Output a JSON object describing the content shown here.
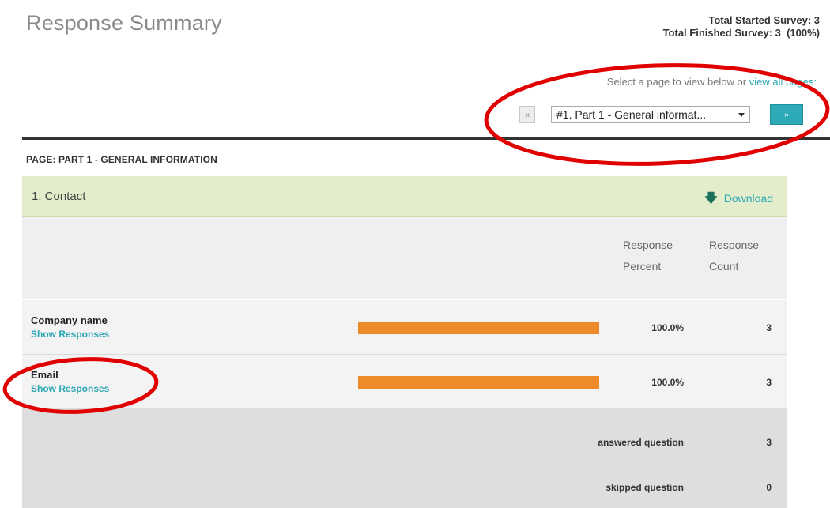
{
  "header": {
    "title": "Response Summary",
    "total_started": "Total Started Survey: 3",
    "total_finished": "Total Finished Survey: 3  (100%)"
  },
  "page_nav": {
    "hint_prefix": "Select a page to view below or ",
    "hint_link": "view all pages",
    "hint_suffix": ":",
    "prev_label": "«",
    "selected_page": "#1. Part 1 - General informat...",
    "next_label": "»"
  },
  "page_label": "PAGE: PART 1 - GENERAL INFORMATION",
  "question": {
    "title": "1. Contact",
    "download_label": "Download",
    "columns": {
      "percent_line1": "Response",
      "percent_line2": "Percent",
      "count_line1": "Response",
      "count_line2": "Count"
    },
    "rows": [
      {
        "label": "Company name",
        "link": "Show Responses",
        "percent": "100.0%",
        "percent_value": 100,
        "count": "3"
      },
      {
        "label": "Email",
        "link": "Show Responses",
        "percent": "100.0%",
        "percent_value": 100,
        "count": "3"
      }
    ],
    "summary": [
      {
        "label": "answered question",
        "value": "3"
      },
      {
        "label": "skipped question",
        "value": "0"
      }
    ]
  },
  "colors": {
    "accent": "#2aa6b5",
    "bar": "#ef8a2b",
    "question_bg": "#e4edcb",
    "annotation": "#e00000"
  },
  "icons": {
    "download": "download-arrow-icon",
    "caret": "chevron-down-icon"
  }
}
